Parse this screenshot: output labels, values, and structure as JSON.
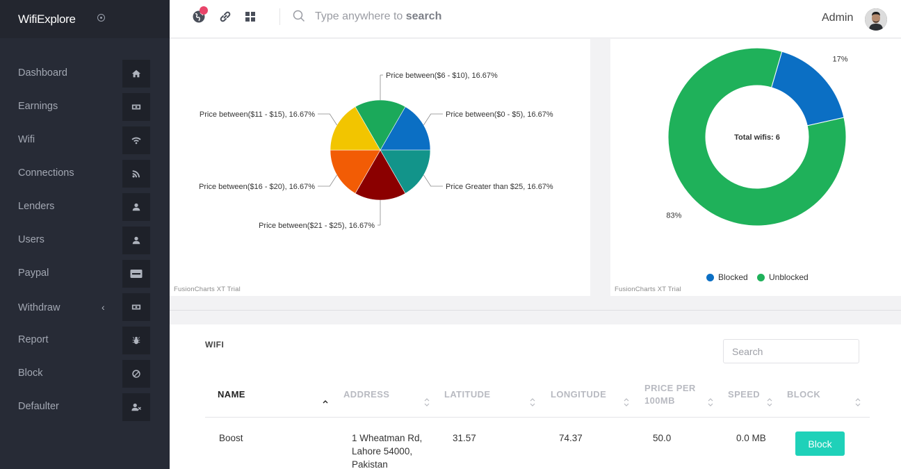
{
  "app": {
    "brand": "WifiExplore"
  },
  "sidebar": {
    "items": [
      {
        "label": "Dashboard",
        "icon": "home-icon"
      },
      {
        "label": "Earnings",
        "icon": "money-icon"
      },
      {
        "label": "Wifi",
        "icon": "wifi-icon"
      },
      {
        "label": "Connections",
        "icon": "rss-icon"
      },
      {
        "label": "Lenders",
        "icon": "user-icon"
      },
      {
        "label": "Users",
        "icon": "user-icon"
      },
      {
        "label": "Paypal",
        "icon": "paypal-icon"
      },
      {
        "label": "Withdraw",
        "icon": "money-icon"
      },
      {
        "label": "Report",
        "icon": "bug-icon"
      },
      {
        "label": "Block",
        "icon": "ban-icon"
      },
      {
        "label": "Defaulter",
        "icon": "user-times-icon"
      }
    ]
  },
  "topbar": {
    "search_prefix": "Type anywhere to ",
    "search_bold": "search",
    "user_name": "Admin"
  },
  "chart_data": [
    {
      "type": "pie",
      "categories": [
        "Price between($0 - $5)",
        "Price Greater than $25",
        "Price between($21 - $25)",
        "Price between($16 - $20)",
        "Price between($11 - $15)",
        "Price between($6 - $10)"
      ],
      "values": [
        16.67,
        16.67,
        16.67,
        16.67,
        16.67,
        16.67
      ],
      "labels": [
        "Price between($0 - $5), 16.67%",
        "Price Greater than $25, 16.67%",
        "Price between($21 - $25), 16.67%",
        "Price between($16 - $20), 16.67%",
        "Price between($11 - $15), 16.67%",
        "Price between($6 - $10), 16.67%"
      ],
      "colors": [
        "#0b6fc4",
        "#12948a",
        "#8b0000",
        "#f25c05",
        "#f2c500",
        "#1ba95a"
      ],
      "watermark": "FusionCharts XT Trial"
    },
    {
      "type": "pie",
      "variant": "doughnut",
      "center_label": "Total wifis: 6",
      "categories": [
        "Blocked",
        "Unblocked"
      ],
      "values": [
        17,
        83
      ],
      "labels": [
        "17%",
        "83%"
      ],
      "colors": [
        "#0b6fc4",
        "#1fb15a"
      ],
      "legend": "bottom",
      "watermark": "FusionCharts XT Trial"
    }
  ],
  "table": {
    "title": "WIFI",
    "search_placeholder": "Search",
    "headers": [
      "NAME",
      "ADDRESS",
      "LATITUDE",
      "LONGITUDE",
      "PRICE PER 100MB",
      "SPEED",
      "BLOCK"
    ],
    "header_price_line1": "PRICE PER",
    "header_price_line2": "100MB",
    "rows": [
      {
        "name": "Boost",
        "address_line1": "1 Wheatman Rd,",
        "address_line2": "Lahore 54000,",
        "address_line3": "Pakistan",
        "latitude": "31.57",
        "longitude": "74.37",
        "price": "50.0",
        "speed": "0.0 MB",
        "action": "Block"
      }
    ]
  },
  "colors": {
    "sidebar": "#272b36",
    "accent": "#1fd1b9",
    "badge": "#e8456a"
  }
}
